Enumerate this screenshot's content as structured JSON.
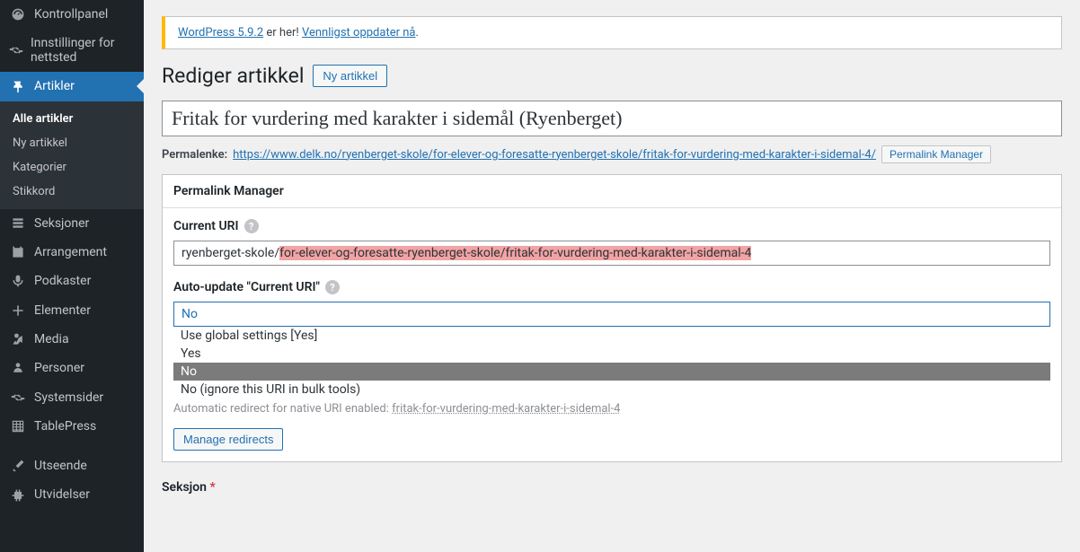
{
  "sidebar": {
    "items": [
      {
        "icon": "gauge",
        "label": "Kontrollpanel"
      },
      {
        "icon": "gear",
        "label": "Innstillinger for nettsted"
      },
      {
        "icon": "pin",
        "label": "Artikler"
      },
      {
        "icon": "layers",
        "label": "Seksjoner"
      },
      {
        "icon": "calendar",
        "label": "Arrangement"
      },
      {
        "icon": "mic",
        "label": "Podkaster"
      },
      {
        "icon": "plus",
        "label": "Elementer"
      },
      {
        "icon": "media",
        "label": "Media"
      },
      {
        "icon": "person",
        "label": "Personer"
      },
      {
        "icon": "gear",
        "label": "Systemsider"
      },
      {
        "icon": "table",
        "label": "TablePress"
      },
      {
        "icon": "brush",
        "label": "Utseende"
      },
      {
        "icon": "plugin",
        "label": "Utvidelser"
      }
    ],
    "submenu": [
      {
        "label": "Alle artikler"
      },
      {
        "label": "Ny artikkel"
      },
      {
        "label": "Kategorier"
      },
      {
        "label": "Stikkord"
      }
    ]
  },
  "notice": {
    "link1": "WordPress 5.9.2",
    "middle": " er her! ",
    "link2": "Vennligst oppdater nå",
    "period": "."
  },
  "heading": "Rediger artikkel",
  "add_new": "Ny artikkel",
  "title_value": "Fritak for vurdering med karakter i sidemål (Ryenberget)",
  "permalink": {
    "label": "Permalenke:",
    "url": "https://www.delk.no/ryenberget-skole/for-elever-og-foresatte-ryenberget-skole/fritak-for-vurdering-med-karakter-i-sidemal-4/",
    "manager_btn": "Permalink Manager"
  },
  "pm": {
    "panel_title": "Permalink Manager",
    "current_uri_label": "Current URI",
    "uri_prefix": "ryenberget-skole/",
    "uri_highlight": "for-elever-og-foresatte-ryenberget-skole/fritak-for-vurdering-med-karakter-i-sidemal-4",
    "auto_update_label": "Auto-update \"Current URI\"",
    "selected": "No",
    "options": [
      "Use global settings [Yes]",
      "Yes",
      "No",
      "No (ignore this URI in bulk tools)"
    ],
    "redirect_text": "Automatic redirect for native URI enabled: ",
    "redirect_link": "fritak-for-vurdering-med-karakter-i-sidemal-4",
    "manage_btn": "Manage redirects"
  },
  "section": {
    "label": "Seksjon",
    "required": "*"
  }
}
